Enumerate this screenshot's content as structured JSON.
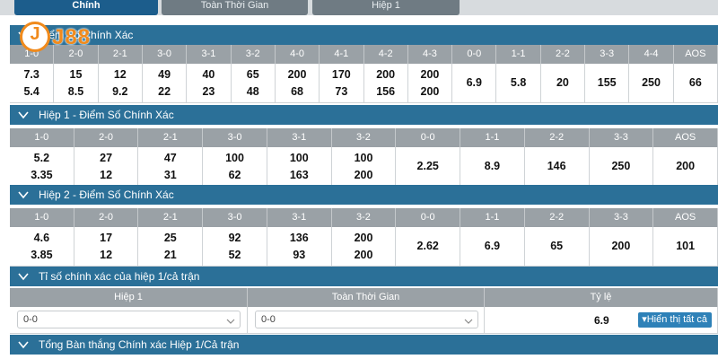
{
  "tabs": [
    {
      "label": "Chính",
      "active": true
    },
    {
      "label": "Toàn Thời Gian",
      "active": false
    },
    {
      "label": "Hiệp 1",
      "active": false
    }
  ],
  "logo": {
    "badge": "J",
    "word": "J88"
  },
  "section1": {
    "title": "Điểm Số Chính Xác",
    "headers": [
      "1-0",
      "2-0",
      "2-1",
      "3-0",
      "3-1",
      "3-2",
      "4-0",
      "4-1",
      "4-2",
      "4-3",
      "0-0",
      "1-1",
      "2-2",
      "3-3",
      "4-4",
      "AOS"
    ],
    "values": [
      [
        "7.3",
        "5.4"
      ],
      [
        "15",
        "8.5"
      ],
      [
        "12",
        "9.2"
      ],
      [
        "49",
        "22"
      ],
      [
        "40",
        "23"
      ],
      [
        "65",
        "48"
      ],
      [
        "200",
        "68"
      ],
      [
        "170",
        "73"
      ],
      [
        "200",
        "156"
      ],
      [
        "200",
        "200"
      ],
      [
        "6.9"
      ],
      [
        "5.8"
      ],
      [
        "20"
      ],
      [
        "155"
      ],
      [
        "250"
      ],
      [
        "66"
      ]
    ]
  },
  "section2": {
    "title": "Hiệp 1 - Điểm Số Chính Xác",
    "headers": [
      "1-0",
      "2-0",
      "2-1",
      "3-0",
      "3-1",
      "3-2",
      "0-0",
      "1-1",
      "2-2",
      "3-3",
      "AOS"
    ],
    "values": [
      [
        "5.2",
        "3.35"
      ],
      [
        "27",
        "12"
      ],
      [
        "47",
        "31"
      ],
      [
        "100",
        "62"
      ],
      [
        "100",
        "163"
      ],
      [
        "100",
        "200"
      ],
      [
        "2.25"
      ],
      [
        "8.9"
      ],
      [
        "146"
      ],
      [
        "250"
      ],
      [
        "200"
      ]
    ]
  },
  "section3": {
    "title": "Hiệp 2 - Điểm Số Chính Xác",
    "headers": [
      "1-0",
      "2-0",
      "2-1",
      "3-0",
      "3-1",
      "3-2",
      "0-0",
      "1-1",
      "2-2",
      "3-3",
      "AOS"
    ],
    "values": [
      [
        "4.6",
        "3.85"
      ],
      [
        "17",
        "12"
      ],
      [
        "25",
        "21"
      ],
      [
        "92",
        "52"
      ],
      [
        "136",
        "93"
      ],
      [
        "200",
        "200"
      ],
      [
        "2.62"
      ],
      [
        "6.9"
      ],
      [
        "65"
      ],
      [
        "200"
      ],
      [
        "101"
      ]
    ]
  },
  "section4": {
    "title": "Tỉ số chính xác của hiệp 1/cả trận",
    "headers": [
      "Hiệp 1",
      "Toàn Thời Gian",
      "Tỷ lệ"
    ],
    "select1": "0-0",
    "select2": "0-0",
    "ratio": "6.9",
    "show_all": "▾Hiển thị tất cả"
  },
  "section5": {
    "title": "Tổng Bàn thắng Chính xác Hiệp 1/Cả trận"
  },
  "colors": {
    "header": "#2b7098",
    "column_header": "#9aa1a6",
    "active_tab": "#1c5d8c",
    "logo": "#f08a1c",
    "button": "#2e81b8"
  }
}
